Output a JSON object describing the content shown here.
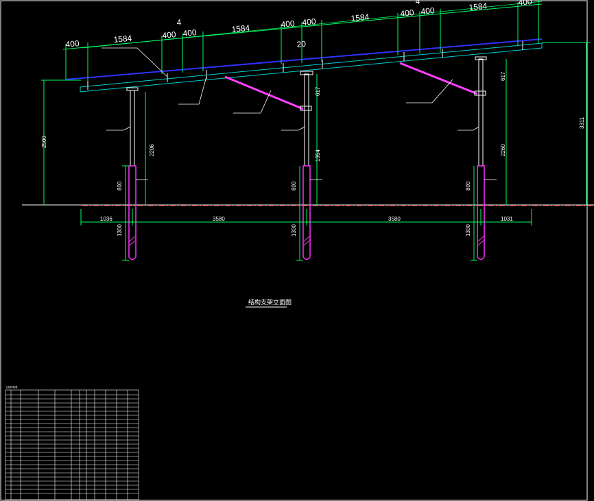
{
  "drawing": {
    "title": "结构支架立面图",
    "table_title": "立柱材料表",
    "top_dims": {
      "segments": [
        "400",
        "1584",
        "400",
        "400",
        "1584",
        "400",
        "400",
        "1584",
        "400",
        "400",
        "1584",
        "400"
      ],
      "module_count_left": "4",
      "module_count_right": "4",
      "total_count": "20"
    },
    "left_dims": {
      "height": "2500",
      "embed_upper": "800",
      "embed_lower": "1300"
    },
    "column_dims": {
      "col1_upper": "2206",
      "col2_upper": "1954",
      "col3_upper": "2260",
      "col2_top": "617",
      "col3_top": "617",
      "col2_embed_upper": "800",
      "col2_embed_lower": "1300",
      "col3_embed_upper": "800",
      "col3_embed_lower": "1300"
    },
    "right_dims": {
      "height": "3311"
    },
    "bottom_dims": [
      "1036",
      "3580",
      "3580",
      "1031"
    ]
  }
}
